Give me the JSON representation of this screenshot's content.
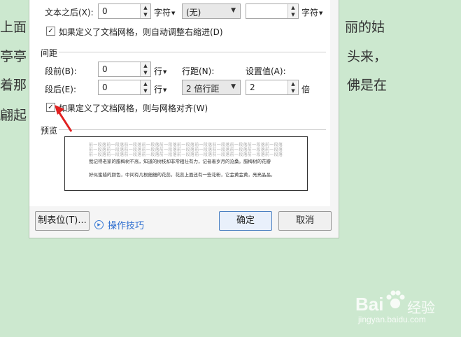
{
  "background_text": [
    "上面",
    "亭亭",
    "着那",
    "翩起",
    "丽的姑",
    "头来，",
    "佛是在"
  ],
  "dialog": {
    "text_after_label": "文本之后(X):",
    "text_after_value": "0",
    "text_after_unit": "字符",
    "special_value": "(无)",
    "special_amount_value": "",
    "special_amount_unit": "字符",
    "auto_indent_label": "如果定义了文档网格，则自动调整右缩进(D)",
    "auto_indent_checked": true,
    "spacing_section": "间距",
    "before_label": "段前(B):",
    "before_value": "0",
    "before_unit": "行",
    "after_label": "段后(E):",
    "after_value": "0",
    "after_unit": "行",
    "line_spacing_label": "行距(N):",
    "line_spacing_value": "2 倍行距",
    "setting_label": "设置值(A):",
    "setting_value": "2",
    "setting_unit": "倍",
    "snap_grid_label": "如果定义了文档网格，则与网格对齐(W)",
    "snap_grid_checked": true,
    "preview_section": "预览",
    "preview_gray_1": "前一段落前一段落前一段落前一段落前一段落前一段落前一段落前一段落前一段落前一段落前一段落前一段落",
    "preview_gray_2": "前一段落前一段落前一段落前一段落前一段落前一段落前一段落前一段落前一段落前一段落前一段落前一段落",
    "preview_gray_3": "前一段落前一段落前一段落前一段落前一段落前一段落前一段落前一段落前一段落前一段落前一段落前一段落",
    "preview_text_1": "我记得老家的腊梅树不高，知道的树枝却非常粗壮有力，记者着岁月的沧桑。腊梅树的花瓣",
    "preview_text_2": "好似蜜蜡的颜色，中间有几根细细的花蕊，花蕊上面还有一些花粉，它金黄金黄，亮亮晶晶，",
    "tabs_button": "制表位(T)...",
    "tips_label": "操作技巧",
    "ok_button": "确定",
    "cancel_button": "取消"
  },
  "watermark": {
    "brand": "Bai",
    "brand_suffix": "经验",
    "url": "jingyan.baidu.com"
  }
}
